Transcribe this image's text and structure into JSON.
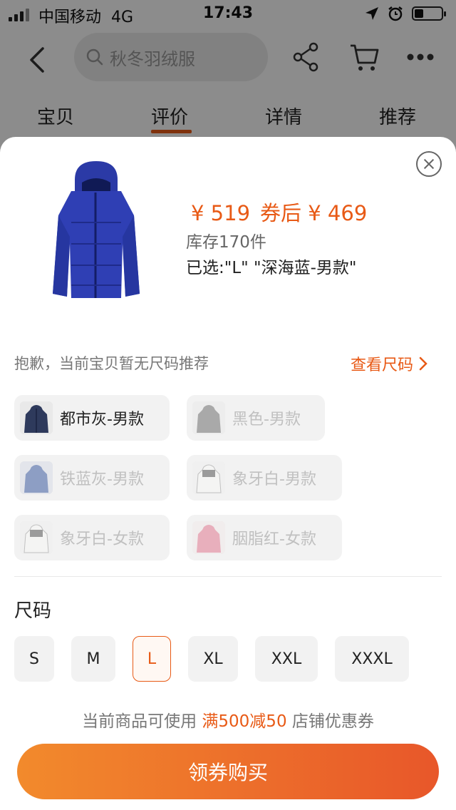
{
  "status_bar": {
    "carrier": "中国移动",
    "network": "4G",
    "time": "17:43"
  },
  "nav": {
    "search_placeholder": "秋冬羽绒服"
  },
  "tabs": [
    {
      "label": "宝贝"
    },
    {
      "label": "评价",
      "active": true
    },
    {
      "label": "详情"
    },
    {
      "label": "推荐"
    }
  ],
  "product": {
    "price": "¥ 519",
    "coupon_price": "券后 ¥ 469",
    "stock": "库存170件",
    "selected": "已选:\"L\" \"深海蓝-男款\""
  },
  "size_hint": {
    "text": "抱歉，当前宝贝暂无尺码推荐",
    "link": "查看尺码"
  },
  "colors": [
    {
      "label": "都市灰-男款",
      "available": true
    },
    {
      "label": "黑色-男款",
      "available": false
    },
    {
      "label": "铁蓝灰-男款",
      "available": false
    },
    {
      "label": "象牙白-男款",
      "available": false
    },
    {
      "label": "象牙白-女款",
      "available": false
    },
    {
      "label": "胭脂红-女款",
      "available": false
    }
  ],
  "size_section": {
    "title": "尺码",
    "options": [
      "S",
      "M",
      "L",
      "XL",
      "XXL",
      "XXXL"
    ],
    "selected": "L"
  },
  "coupon_note": {
    "prefix": "当前商品可使用",
    "highlight": "满500减50",
    "suffix": "店铺优惠券"
  },
  "buy_button": "领券购买",
  "accent_color": "#e85a16"
}
